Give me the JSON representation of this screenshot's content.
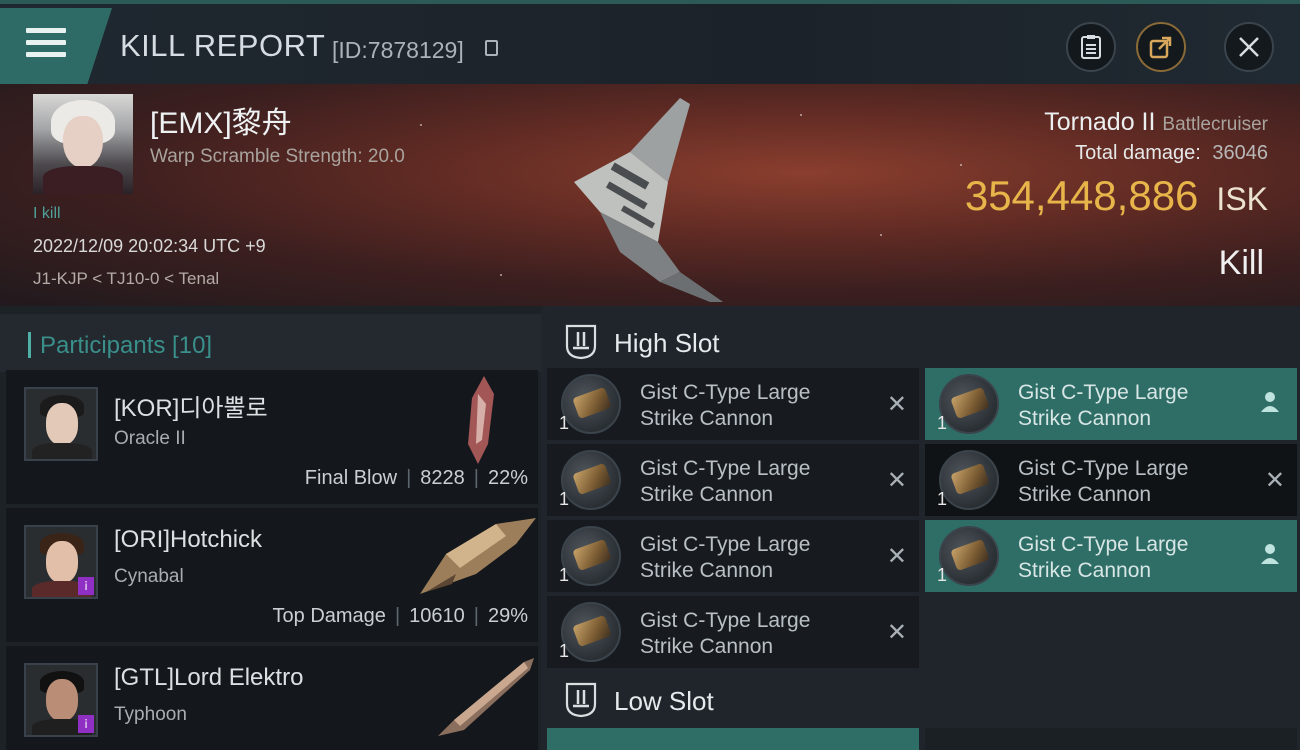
{
  "header": {
    "title": "KILL REPORT",
    "kill_id": "[ID:7878129]",
    "buttons": {
      "report_icon": "clipboard-icon",
      "share_icon": "share-icon",
      "close_icon": "close-icon"
    }
  },
  "victim": {
    "name": "[EMX]黎舟",
    "warp_scramble": "Warp Scramble Strength: 20.0",
    "kills_label": "I kill",
    "time": "2022/12/09 20:02:34 UTC +9",
    "location": "J1-KJP < TJ10-0 < Tenal",
    "ship_name": "Tornado II",
    "ship_class": "Battlecruiser",
    "total_damage_label": "Total damage:",
    "total_damage": "36046",
    "isk_value": "354,448,886",
    "isk_unit": "ISK",
    "kill_type": "Kill"
  },
  "participants": {
    "label": "Participants [10]",
    "items": [
      {
        "name": "[KOR]디아뿔로",
        "ship": "Oracle II",
        "role": "Final Blow",
        "damage": "8228",
        "percent": "22%",
        "badge": false,
        "skin": "#e3c9b8",
        "hair": "#1b1b1b",
        "body": "#222"
      },
      {
        "name": "[ORI]Hotchick",
        "ship": "Cynabal",
        "role": "Top Damage",
        "damage": "10610",
        "percent": "29%",
        "badge": true,
        "skin": "#e2bfa9",
        "hair": "#3a2418",
        "body": "#5a2a2a"
      },
      {
        "name": "[GTL]Lord Elektro",
        "ship": "Typhoon",
        "badge": true,
        "skin": "#b98d76",
        "hair": "#111",
        "body": "#1f1f1f"
      }
    ]
  },
  "slots": {
    "high_label": "High Slot",
    "low_label": "Low Slot",
    "module_name_line1": "Gist C-Type Large",
    "module_name_line2": "Strike Cannon",
    "high_modules": [
      {
        "qty": "1",
        "state": "destroyed"
      },
      {
        "qty": "1",
        "state": "dropped"
      },
      {
        "qty": "1",
        "state": "destroyed"
      },
      {
        "qty": "1",
        "state": "destroyed"
      },
      {
        "qty": "1",
        "state": "destroyed"
      },
      {
        "qty": "1",
        "state": "dropped"
      },
      {
        "qty": "1",
        "state": "destroyed"
      }
    ]
  },
  "colors": {
    "accent_teal": "#2f6e67",
    "isk_gold": "#e8b54a",
    "purple_badge": "#8f2fc4"
  }
}
